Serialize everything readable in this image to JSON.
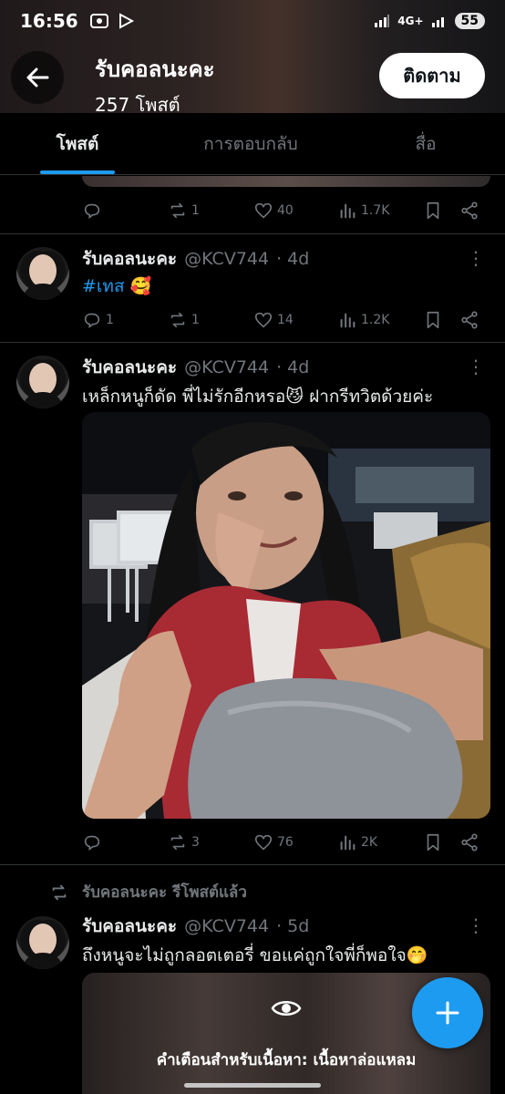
{
  "status_bar": {
    "time": "16:56",
    "network": "4G+",
    "battery": "55"
  },
  "header": {
    "name": "รับคอลนะคะ",
    "post_count": "257 โพสต์",
    "follow_label": "ติดตาม"
  },
  "tabs": [
    {
      "label": "โพสต์",
      "active": true
    },
    {
      "label": "การตอบกลับ",
      "active": false
    },
    {
      "label": "สื่อ",
      "active": false
    }
  ],
  "posts": [
    {
      "stats": {
        "replies": "",
        "reposts": "1",
        "likes": "40",
        "views": "1.7K"
      }
    },
    {
      "name": "รับคอลนะคะ",
      "handle": "@KCV744",
      "time": "· 4d",
      "hashtag": "#เทส",
      "emoji": "🥰",
      "stats": {
        "replies": "1",
        "reposts": "1",
        "likes": "14",
        "views": "1.2K"
      }
    },
    {
      "name": "รับคอลนะคะ",
      "handle": "@KCV744",
      "time": "· 4d",
      "text": "เหล็กหนูก็ดัด พี่ไม่รักอีกหรอ😼 ฝากรีทวิตด้วยค่ะ",
      "stats": {
        "replies": "",
        "reposts": "3",
        "likes": "76",
        "views": "2K"
      }
    },
    {
      "repost_label": "รับคอลนะคะ รีโพสต์แล้ว",
      "name": "รับคอลนะคะ",
      "handle": "@KCV744",
      "time": "· 5d",
      "text": "ถึงหนูจะไม่ถูกลอตเตอรี่ ขอแค่ถูกใจพี่ก็พอใจ🤭",
      "warning": "คำเตือนสำหรับเนื้อหา: เนื้อหาล่อแหลม"
    }
  ],
  "icons": [
    "back-arrow-icon",
    "reply-icon",
    "repost-icon",
    "like-icon",
    "views-icon",
    "bookmark-icon",
    "share-icon",
    "more-icon",
    "eye-icon",
    "plus-icon"
  ],
  "colors": {
    "accent": "#1d9bf0",
    "muted": "#71767b",
    "text": "#e7e9ea"
  }
}
